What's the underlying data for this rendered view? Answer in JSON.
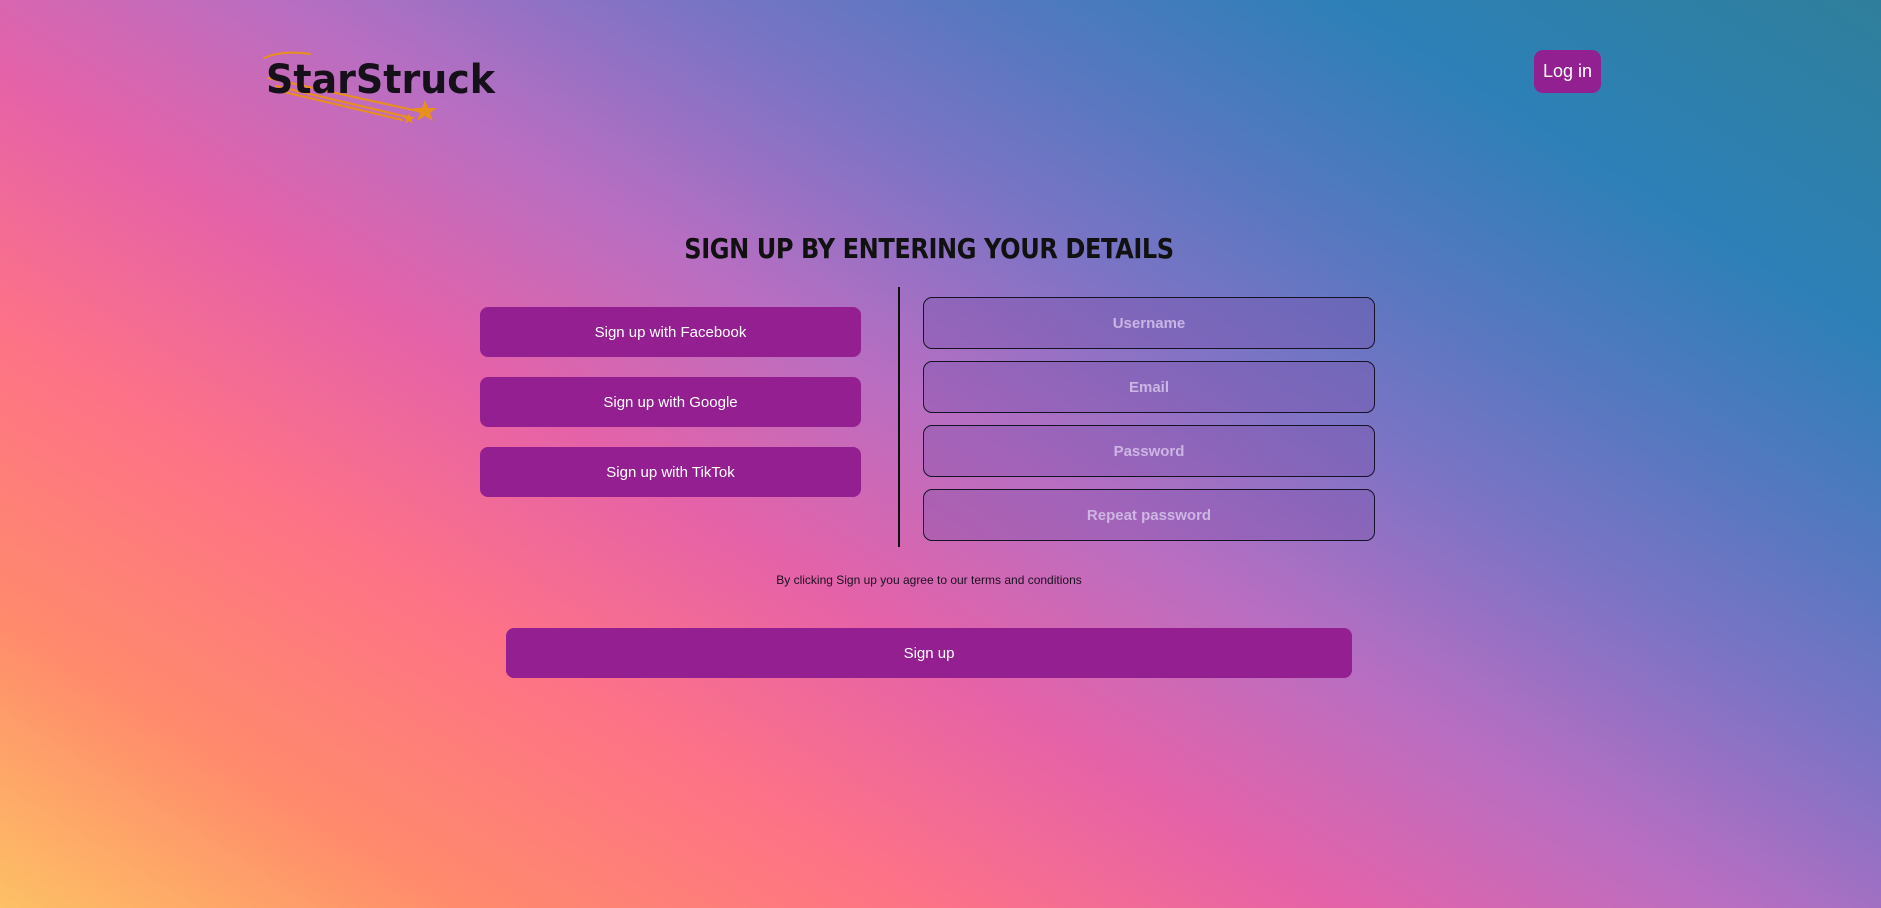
{
  "brand": {
    "name": "StarStruck",
    "accent_color": "#931f91",
    "logo_star_color": "#e8901c"
  },
  "header": {
    "login_label": "Log in"
  },
  "signup": {
    "heading": "SIGN UP BY ENTERING YOUR DETAILS",
    "social_buttons": [
      {
        "label": "Sign up with Facebook"
      },
      {
        "label": "Sign up with Google"
      },
      {
        "label": "Sign up with TikTok"
      }
    ],
    "fields": {
      "username": {
        "placeholder": "Username",
        "value": ""
      },
      "email": {
        "placeholder": "Email",
        "value": ""
      },
      "password": {
        "placeholder": "Password",
        "value": ""
      },
      "repeat_password": {
        "placeholder": "Repeat password",
        "value": ""
      }
    },
    "terms_text": "By clicking Sign up you agree to our terms and conditions",
    "submit_label": "Sign up"
  }
}
